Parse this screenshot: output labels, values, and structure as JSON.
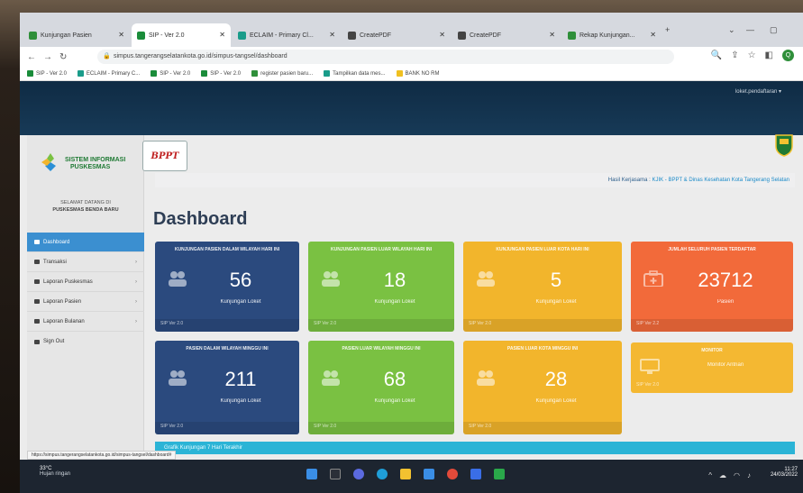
{
  "browser": {
    "tabs": [
      {
        "label": "Kunjungan Pasien",
        "color": "#2f8f3a"
      },
      {
        "label": "SIP - Ver 2.0",
        "color": "#1a8c3a"
      },
      {
        "label": "ECLAIM - Primary Cl...",
        "color": "#1a9c8a"
      },
      {
        "label": "CreatePDF",
        "color": "#444444"
      },
      {
        "label": "CreatePDF",
        "color": "#444444"
      },
      {
        "label": "Rekap Kunjungan...",
        "color": "#2f8f3a"
      }
    ],
    "new_tab": "+",
    "url": "simpus.tangerangselatankota.go.id/simpus-tangsel/dashboard",
    "bookmarks": [
      {
        "label": "SIP - Ver 2.0",
        "color": "#1a8c3a"
      },
      {
        "label": "ECLAIM - Primary C...",
        "color": "#1a9c8a"
      },
      {
        "label": "SIP - Ver 2.0",
        "color": "#1a8c3a"
      },
      {
        "label": "SIP - Ver 2.0",
        "color": "#1a8c3a"
      },
      {
        "label": "register pasien baru...",
        "color": "#2f8f3a"
      },
      {
        "label": "Tampilkan data mes...",
        "color": "#1a9c8a"
      },
      {
        "label": "BANK NO RM",
        "color": "#f0c020"
      }
    ],
    "profile_initial": "Q"
  },
  "app": {
    "user_menu": "loket.pendaftaran ▾",
    "brand_logo": "BPPT",
    "logo_line1": "SISTEM INFORMASI",
    "logo_line2": "PUSKESMAS",
    "welcome_line1": "SELAMAT DATANG DI",
    "welcome_line2": "PUSKESMAS BENDA BARU",
    "menu": [
      {
        "label": "Dashboard",
        "active": true
      },
      {
        "label": "Transaksi",
        "active": false
      },
      {
        "label": "Laporan Puskesmas",
        "active": false
      },
      {
        "label": "Laporan Pasien",
        "active": false
      },
      {
        "label": "Laporan Bulanan",
        "active": false
      },
      {
        "label": "Sign Out",
        "active": false
      }
    ],
    "breadcrumb_prefix": "Hasil Kerjasama : ",
    "breadcrumb_highlight": "KJIK - BPPT & Dinas Kesehatan Kota Tangerang Selatan",
    "page_title": "Dashboard",
    "cards": [
      {
        "title": "KUNJUNGAN PASIEN DALAM WILAYAH HARI INI",
        "value": "56",
        "unit": "Kunjungan Loket",
        "version": "SIP Ver 2.0",
        "color": "navy"
      },
      {
        "title": "KUNJUNGAN PASIEN LUAR WILAYAH HARI INI",
        "value": "18",
        "unit": "Kunjungan Loket",
        "version": "SIP Ver 2.0",
        "color": "green"
      },
      {
        "title": "KUNJUNGAN PASIEN LUAR KOTA HARI INI",
        "value": "5",
        "unit": "Kunjungan Loket",
        "version": "SIP Ver 2.0",
        "color": "yellow"
      },
      {
        "title": "JUMLAH SELURUH PASIEN TERDAFTAR",
        "value": "23712",
        "unit": "Pasien",
        "version": "SIP Ver 2.2",
        "color": "orange"
      },
      {
        "title": "PASIEN DALAM WILAYAH MINGGU INI",
        "value": "211",
        "unit": "Kunjungan Loket",
        "version": "SIP Ver 2.0",
        "color": "navy"
      },
      {
        "title": "PASIEN LUAR WILAYAH MINGGU INI",
        "value": "68",
        "unit": "Kunjungan Loket",
        "version": "SIP Ver 2.0",
        "color": "green"
      },
      {
        "title": "PASIEN LUAR KOTA MINGGU INI",
        "value": "28",
        "unit": "Kunjungan Loket",
        "version": "SIP Ver 2.0",
        "color": "yellow"
      },
      {
        "title": "MONITOR",
        "value": "",
        "unit": "Monitor Antrian",
        "version": "SIP Ver 2.0",
        "color": "yellow2"
      }
    ],
    "bottom_strip": "Grafik Kunjungan 7 Hari Terakhir",
    "status_url": "https://simpus.tangerangselatankota.go.id/simpus-tangsel/dashboard#"
  },
  "taskbar": {
    "temp": "33°C",
    "weather": "Hujan ringan",
    "time": "11:27",
    "date": "24/03/2022"
  }
}
